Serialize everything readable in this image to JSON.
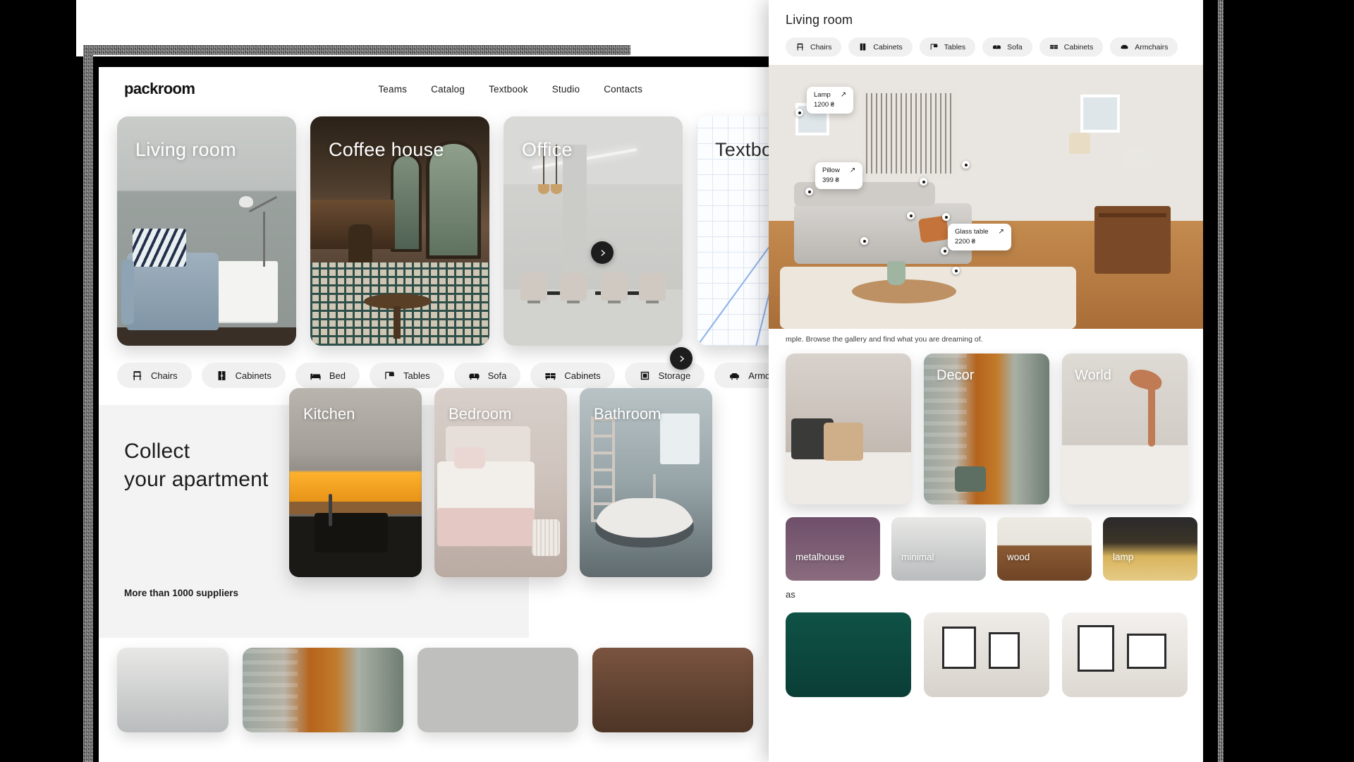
{
  "site": {
    "brand": "packroom",
    "nav": [
      {
        "label": "Teams"
      },
      {
        "label": "Catalog"
      },
      {
        "label": "Textbook"
      },
      {
        "label": "Studio"
      },
      {
        "label": "Contacts"
      }
    ],
    "icons": {
      "search": "search-icon",
      "account": "account-icon",
      "next": "chevron-right-icon"
    }
  },
  "hero": {
    "cards": [
      {
        "label": "Living room"
      },
      {
        "label": "Coffee house"
      },
      {
        "label": "Office"
      },
      {
        "label": "Textbook"
      }
    ],
    "next_label": "›"
  },
  "chips": [
    {
      "label": "Chairs",
      "icon": "chair-icon"
    },
    {
      "label": "Cabinets",
      "icon": "cabinet-icon"
    },
    {
      "label": "Bed",
      "icon": "bed-icon"
    },
    {
      "label": "Tables",
      "icon": "table-icon"
    },
    {
      "label": "Sofa",
      "icon": "sofa-icon"
    },
    {
      "label": "Cabinets",
      "icon": "sideboard-icon"
    },
    {
      "label": "Storage",
      "icon": "storage-icon"
    },
    {
      "label": "Armchairs",
      "icon": "armchair-icon"
    }
  ],
  "collect": {
    "title_line1": "Collect",
    "title_line2": "your apartment",
    "subtitle": "More than 1000 suppliers",
    "rooms": [
      {
        "label": "Kitchen"
      },
      {
        "label": "Bedroom"
      },
      {
        "label": "Bathroom"
      }
    ]
  },
  "panel": {
    "title": "Living room",
    "chips": [
      {
        "label": "Chairs",
        "icon": "chair-icon"
      },
      {
        "label": "Cabinets",
        "icon": "cabinet-icon"
      },
      {
        "label": "Tables",
        "icon": "table-icon"
      },
      {
        "label": "Sofa",
        "icon": "sofa-icon"
      },
      {
        "label": "Cabinets",
        "icon": "sideboard-icon"
      },
      {
        "label": "Armchairs",
        "icon": "armchair-icon"
      }
    ],
    "tags": [
      {
        "name": "Lamp",
        "price": "1200 ₴",
        "arrow": "↗"
      },
      {
        "name": "Pillow",
        "price": "399 ₴",
        "arrow": "↗"
      },
      {
        "name": "Glass table",
        "price": "2200 ₴",
        "arrow": "↗"
      }
    ],
    "caption": "mple. Browse the gallery and find what you are dreaming of.",
    "cards": [
      {
        "label": ""
      },
      {
        "label": "Decor"
      },
      {
        "label": "World"
      }
    ],
    "thumbs": [
      {
        "label": "metalhouse"
      },
      {
        "label": "minimal"
      },
      {
        "label": "wood"
      },
      {
        "label": "lamp"
      }
    ],
    "partial_heading": "as"
  },
  "colors": {
    "accent": "#1d1d1d",
    "chip_bg": "#f0f0f0",
    "panel_bg": "#ffffff",
    "section_bg": "#f3f3f3"
  }
}
